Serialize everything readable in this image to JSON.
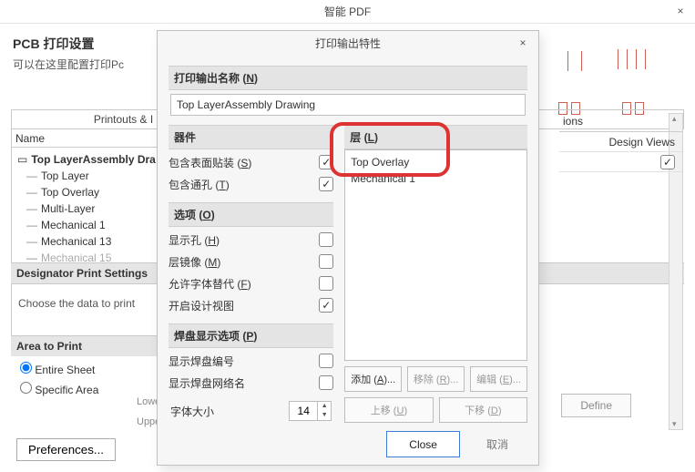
{
  "outer": {
    "title": "智能 PDF",
    "pcb_title": "PCB 打印设置",
    "pcb_sub": "可以在这里配置打印Pc",
    "printouts_label": "Printouts & I",
    "name_header": "Name",
    "tree_root": "Top LayerAssembly Dra",
    "tree_children": [
      "Top Layer",
      "Top Overlay",
      "Multi-Layer",
      "Mechanical 1",
      "Mechanical 13",
      "Mechanical 15"
    ],
    "designator_hdr": "Designator Print Settings",
    "choose_text": "Choose the data to print",
    "area_hdr": "Area to Print",
    "area_opts": [
      "Entire Sheet",
      "Specific Area"
    ],
    "lowe": "Lowe",
    "uppe": "Uppe",
    "prefs": "Preferences...",
    "views_hdr": "ions",
    "views_row": "Design Views",
    "define": "Define"
  },
  "dialog": {
    "title": "打印输出特性",
    "name_hdr_label": "打印输出名称",
    "name_hdr_hot": "N",
    "name_value": "Top LayerAssembly Drawing",
    "qj_hdr": "器件",
    "opt_smt": "包含表面贴装",
    "opt_smt_hot": "S",
    "opt_via": "包含通孔",
    "opt_via_hot": "T",
    "xopt_hdr": "选项",
    "xopt_hot": "O",
    "opt_hole": "显示孔",
    "opt_hole_hot": "H",
    "opt_mirror": "层镜像",
    "opt_mirror_hot": "M",
    "opt_font": "允许字体替代",
    "opt_font_hot": "F",
    "opt_dv": "开启设计视图",
    "pad_hdr": "焊盘显示选项",
    "pad_hot": "P",
    "opt_padnum": "显示焊盘编号",
    "opt_padnet": "显示焊盘网络名",
    "fontsize_label": "字体大小",
    "fontsize_value": "14",
    "layer_hdr": "层",
    "layer_hot": "L",
    "layer_items": [
      "Top Overlay",
      "Mechanical 1"
    ],
    "btn_add": "添加",
    "btn_add_hot": "A",
    "btn_del": "移除",
    "btn_del_hot": "R",
    "btn_edit": "编辑",
    "btn_edit_hot": "E",
    "btn_up": "上移",
    "btn_up_hot": "U",
    "btn_dn": "下移",
    "btn_dn_hot": "D",
    "close": "Close",
    "cancel": "取消"
  }
}
